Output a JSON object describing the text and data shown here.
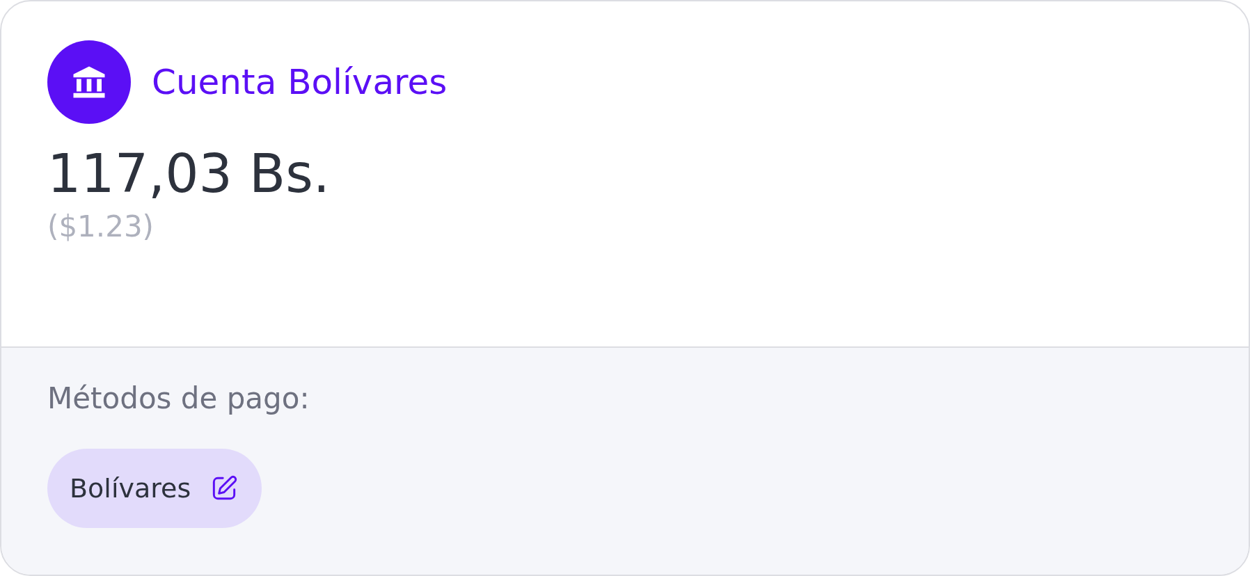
{
  "account": {
    "title": "Cuenta Bolívares",
    "amount": "117,03 Bs.",
    "converted": "($1.23)"
  },
  "payment_methods": {
    "label": "Métodos de pago:",
    "items": [
      {
        "label": "Bolívares"
      }
    ]
  }
}
